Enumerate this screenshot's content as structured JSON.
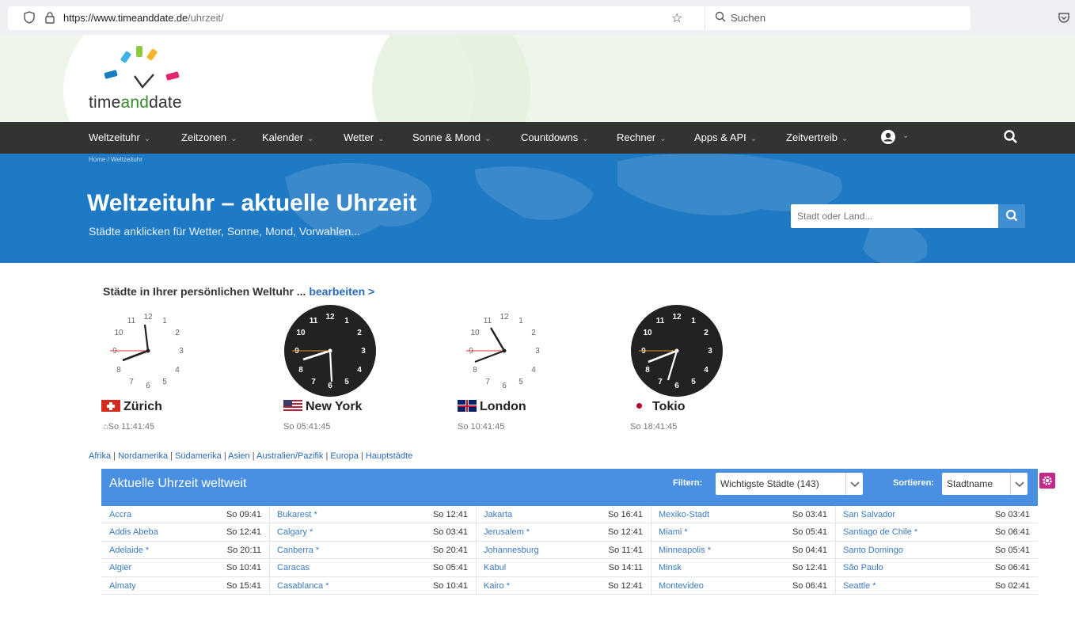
{
  "browser": {
    "url_host": "https://www.timeanddate.de",
    "url_path": "/uhrzeit/",
    "search_placeholder": "Suchen"
  },
  "logo": {
    "word_pre": "time",
    "word_mid": "and",
    "word_post": "date"
  },
  "nav": {
    "items": [
      "Weltzeituhr",
      "Zeitzonen",
      "Kalender",
      "Wetter",
      "Sonne & Mond",
      "Countdowns",
      "Rechner",
      "Apps & API",
      "Zeitvertreib"
    ]
  },
  "hero": {
    "breadcrumb": "Home / Weltzeituhr",
    "title": "Weltzeituhr – aktuelle Uhrzeit",
    "subtitle": "Städte anklicken für Wetter, Sonne, Mond, Vorwahlen...",
    "search_placeholder": "Stadt oder Land..."
  },
  "personal": {
    "heading": "Städte in Ihrer persönlichen Weltuhr ... ",
    "edit_link": "bearbeiten >"
  },
  "clocks": [
    {
      "city": "Zürich",
      "time": "So 11:41:45",
      "home": true,
      "dark": false
    },
    {
      "city": "New York",
      "time": "So 05:41:45",
      "home": false,
      "dark": true
    },
    {
      "city": "London",
      "time": "So 10:41:45",
      "home": false,
      "dark": false
    },
    {
      "city": "Tokio",
      "time": "So 18:41:45",
      "home": false,
      "dark": true
    }
  ],
  "regions": [
    "Afrika",
    "Nordamerika",
    "Südamerika",
    "Asien",
    "Australien/Pazifik",
    "Europa",
    "Hauptstädte"
  ],
  "table": {
    "title": "Aktuelle Uhrzeit weltweit",
    "filter_label": "Filtern:",
    "filter_value": "Wichtigste Städte (143)",
    "sort_label": "Sortieren:",
    "sort_value": "Stadtname",
    "rows": [
      [
        [
          "Accra",
          "So 09:41"
        ],
        [
          "Bukarest *",
          "So 12:41"
        ],
        [
          "Jakarta",
          "So 16:41"
        ],
        [
          "Mexiko-Stadt",
          "So 03:41"
        ],
        [
          "San Salvador",
          "So 03:41"
        ]
      ],
      [
        [
          "Addis Abeba",
          "So 12:41"
        ],
        [
          "Calgary *",
          "So 03:41"
        ],
        [
          "Jerusalem *",
          "So 12:41"
        ],
        [
          "Miami *",
          "So 05:41"
        ],
        [
          "Santiago de Chile *",
          "So 06:41"
        ]
      ],
      [
        [
          "Adelaide *",
          "So 20:11"
        ],
        [
          "Canberra *",
          "So 20:41"
        ],
        [
          "Johannesburg",
          "So 11:41"
        ],
        [
          "Minneapolis *",
          "So 04:41"
        ],
        [
          "Santo Domingo",
          "So 05:41"
        ]
      ],
      [
        [
          "Algier",
          "So 10:41"
        ],
        [
          "Caracas",
          "So 05:41"
        ],
        [
          "Kabul",
          "So 14:11"
        ],
        [
          "Minsk",
          "So 12:41"
        ],
        [
          "São Paulo",
          "So 06:41"
        ]
      ],
      [
        [
          "Almaty",
          "So 15:41"
        ],
        [
          "Casablanca *",
          "So 10:41"
        ],
        [
          "Kairo *",
          "So 12:41"
        ],
        [
          "Montevideo",
          "So 06:41"
        ],
        [
          "Seattle *",
          "So 02:41"
        ]
      ]
    ]
  }
}
